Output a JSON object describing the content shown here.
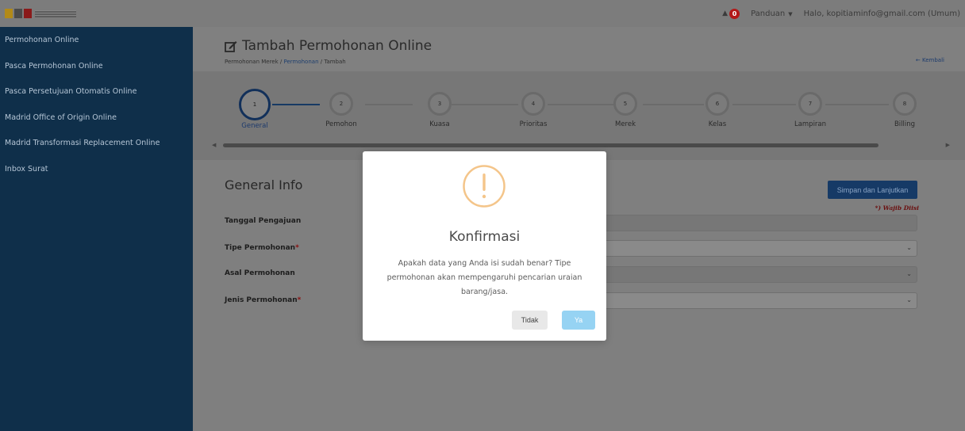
{
  "topbar": {
    "notification_count": "0",
    "guide_label": "Panduan",
    "greeting": "Halo, kopitiaminfo@gmail.com (Umum)"
  },
  "sidebar": {
    "items": [
      {
        "label": "Permohonan Online"
      },
      {
        "label": "Pasca Permohonan Online"
      },
      {
        "label": "Pasca Persetujuan Otomatis Online"
      },
      {
        "label": "Madrid Office of Origin Online"
      },
      {
        "label": "Madrid Transformasi Replacement Online"
      },
      {
        "label": "Inbox Surat"
      }
    ]
  },
  "header": {
    "title": "Tambah Permohonan Online",
    "breadcrumb": {
      "part1": "Permohonan Merek / ",
      "link": "Permohonan",
      "part3": " / Tambah"
    },
    "back_label": "← Kembali"
  },
  "stepper": {
    "steps": [
      {
        "num": "1",
        "label": "General"
      },
      {
        "num": "2",
        "label": "Pemohon"
      },
      {
        "num": "3",
        "label": "Kuasa"
      },
      {
        "num": "4",
        "label": "Prioritas"
      },
      {
        "num": "5",
        "label": "Merek"
      },
      {
        "num": "6",
        "label": "Kelas"
      },
      {
        "num": "7",
        "label": "Lampiran"
      },
      {
        "num": "8",
        "label": "Billing"
      }
    ]
  },
  "form": {
    "section_title": "General Info",
    "save_label": "Simpan dan Lanjutkan",
    "required_note": "*) Wajib Diisi",
    "fields": [
      {
        "label": "Tanggal Pengajuan",
        "required": ""
      },
      {
        "label": "Tipe Permohonan",
        "required": "*"
      },
      {
        "label": "Asal Permohonan",
        "required": ""
      },
      {
        "label": "Jenis Permohonan",
        "required": "*"
      }
    ]
  },
  "modal": {
    "title": "Konfirmasi",
    "message": "Apakah data yang Anda isi sudah benar? Tipe permohonan akan mempengaruhi pencarian uraian barang/jasa.",
    "cancel_label": "Tidak",
    "confirm_label": "Ya",
    "icon": "warning-circle-icon"
  }
}
